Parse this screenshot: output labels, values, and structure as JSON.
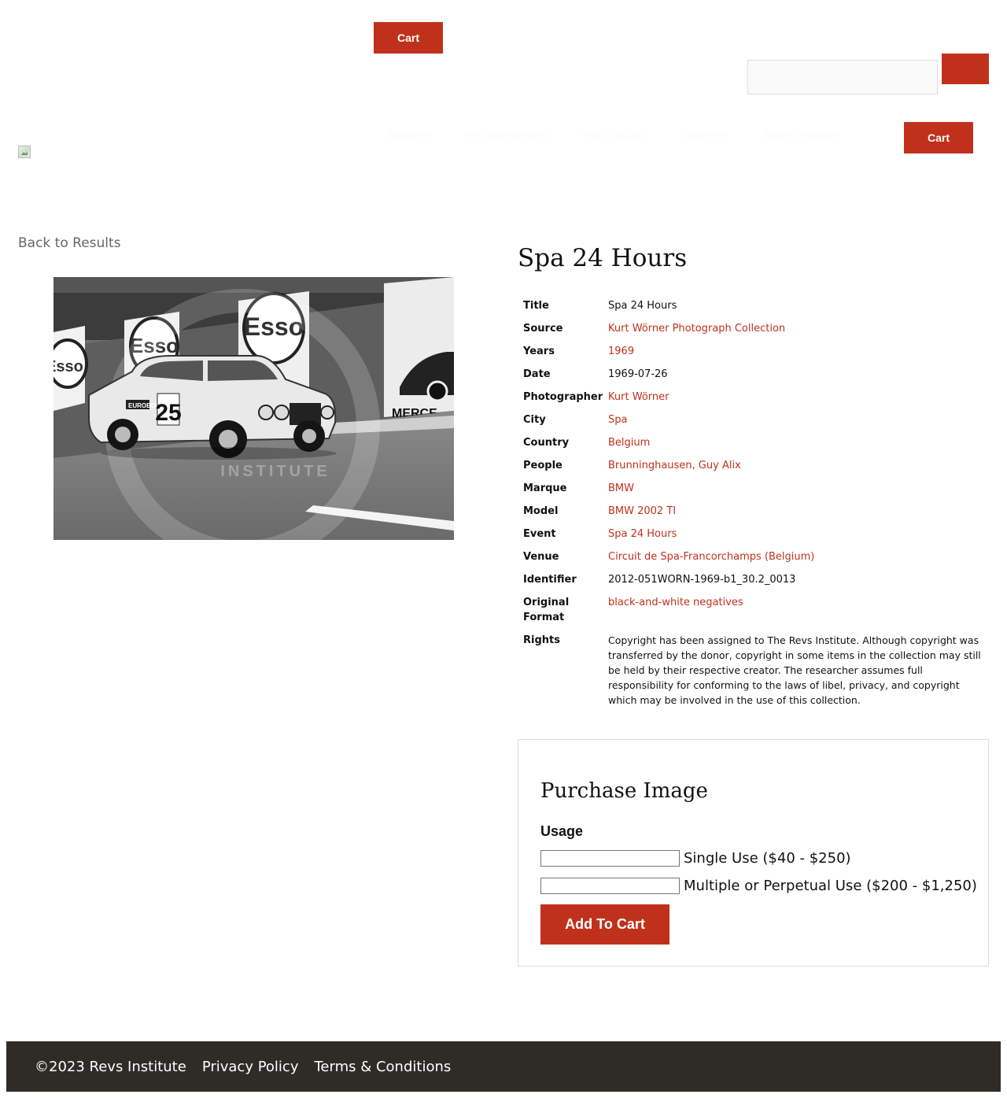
{
  "header": {
    "cart_label": "Cart",
    "search": {
      "placeholder": "",
      "button_label": ""
    },
    "nav": [
      "Browse",
      "Photographers",
      "Purchasing",
      "Flagging",
      "Revs Institute"
    ],
    "nav_cart_label": "Cart"
  },
  "back_link": "Back to Results",
  "item": {
    "title": "Spa 24 Hours",
    "metadata": [
      {
        "key": "Title",
        "value": "Spa 24 Hours",
        "link": false
      },
      {
        "key": "Source",
        "value": "Kurt Wörner Photograph Collection",
        "link": true
      },
      {
        "key": "Years",
        "value": "1969",
        "link": true
      },
      {
        "key": "Date",
        "value": "1969-07-26",
        "link": false
      },
      {
        "key": "Photographer",
        "value": "Kurt Wörner",
        "link": true
      },
      {
        "key": "City",
        "value": "Spa",
        "link": true
      },
      {
        "key": "Country",
        "value": "Belgium",
        "link": true
      },
      {
        "key": "People",
        "value": "Brunninghausen, Guy Alix",
        "link": true
      },
      {
        "key": "Marque",
        "value": "BMW",
        "link": true
      },
      {
        "key": "Model",
        "value": "BMW 2002 TI",
        "link": true
      },
      {
        "key": "Event",
        "value": "Spa 24 Hours",
        "link": true
      },
      {
        "key": "Venue",
        "value": "Circuit de Spa-Francorchamps (Belgium)",
        "link": true
      },
      {
        "key": "Identifier",
        "value": "2012-051WORN-1969-b1_30.2_0013",
        "link": false
      },
      {
        "key": "Original Format",
        "value": "black-and-white negatives",
        "link": true
      },
      {
        "key": "Rights",
        "value": "Copyright has been assigned to The Revs Institute. Although copyright was transferred by the donor, copyright in some items in the collection may still be held by their respective creator. The researcher assumes full responsibility for conforming to the laws of libel, privacy, and copyright which may be involved in the use of this collection.",
        "link": false
      }
    ]
  },
  "photo": {
    "sign_text": "Esso",
    "car_number": "25",
    "car_sticker": "EUROBOR",
    "watermark": "INSTITUTE",
    "ad_text": "MERCE"
  },
  "purchase": {
    "title": "Purchase Image",
    "usage_label": "Usage",
    "options": [
      "Single Use ($40 - $250)",
      "Multiple or Perpetual Use ($200 - $1,250)"
    ],
    "add_to_cart_label": "Add To Cart"
  },
  "footer": {
    "copyright": "©2023 Revs Institute",
    "privacy": "Privacy Policy",
    "terms": "Terms & Conditions"
  },
  "colors": {
    "accent": "#c0311c",
    "footer_bg": "#2f2b27",
    "border": "#dddddd"
  }
}
